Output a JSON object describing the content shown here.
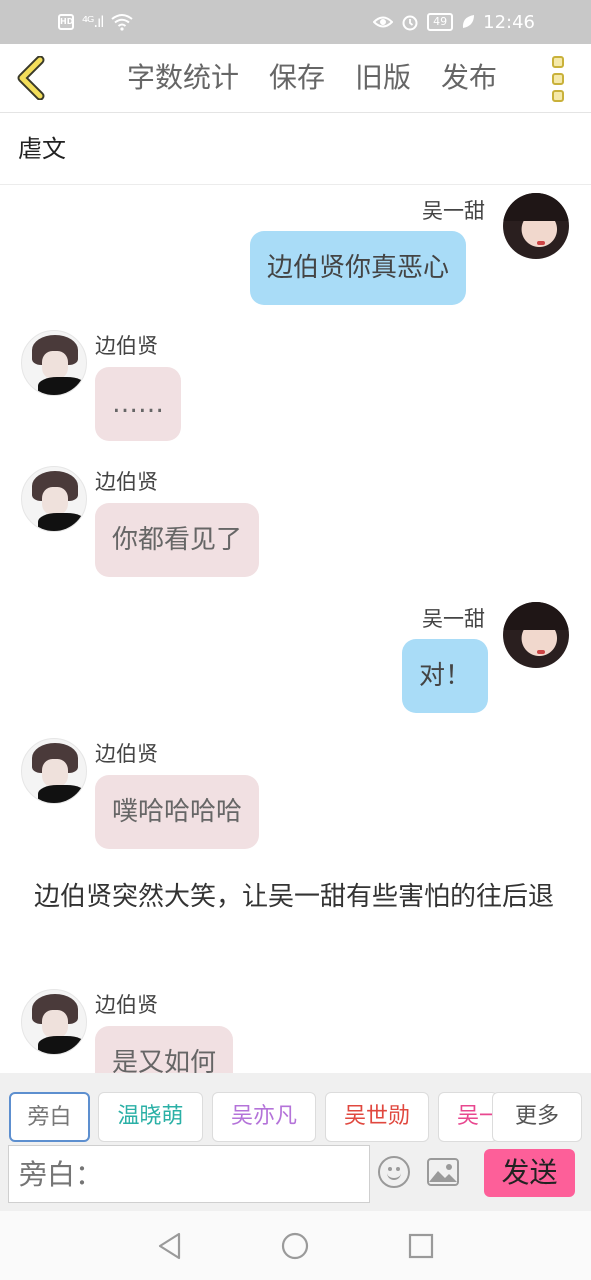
{
  "status_bar": {
    "network": "HD",
    "signal": "⁴ᴳ.ıl",
    "battery": "49",
    "time": "12:46"
  },
  "toolbar": {
    "back_icon": "chevron-left-icon",
    "items": [
      "字数统计",
      "保存",
      "旧版",
      "发布"
    ],
    "more_icon": "vertical-dots-icon"
  },
  "title": "虐文",
  "messages": [
    {
      "side": "right",
      "name": "吴一甜",
      "text": "边伯贤你真恶心"
    },
    {
      "side": "left",
      "name": "边伯贤",
      "text": "……"
    },
    {
      "side": "left",
      "name": "边伯贤",
      "text": "你都看见了"
    },
    {
      "side": "right",
      "name": "吴一甜",
      "text": "对！"
    },
    {
      "side": "left",
      "name": "边伯贤",
      "text": "噗哈哈哈哈"
    },
    {
      "side": "narration",
      "text": "边伯贤突然大笑，让吴一甜有些害怕的往后退"
    },
    {
      "side": "left",
      "name": "边伯贤",
      "text": "是又如何"
    }
  ],
  "roles": [
    {
      "label": "旁白",
      "color": "#777777",
      "active": true
    },
    {
      "label": "温晓萌",
      "color": "#2ab0a6",
      "active": false
    },
    {
      "label": "吴亦凡",
      "color": "#b473d9",
      "active": false
    },
    {
      "label": "吴世勋",
      "color": "#e0483f",
      "active": false
    },
    {
      "label": "吴一甜",
      "color": "#e8478f",
      "active": false
    },
    {
      "label": "更多",
      "color": "#555555",
      "active": false
    }
  ],
  "input": {
    "placeholder": "旁白：",
    "emoji_icon": "emoji-icon",
    "image_icon": "image-icon",
    "send_label": "发送"
  },
  "nav": {
    "back_icon": "nav-back-icon",
    "home_icon": "nav-home-icon",
    "recents_icon": "nav-recents-icon"
  }
}
